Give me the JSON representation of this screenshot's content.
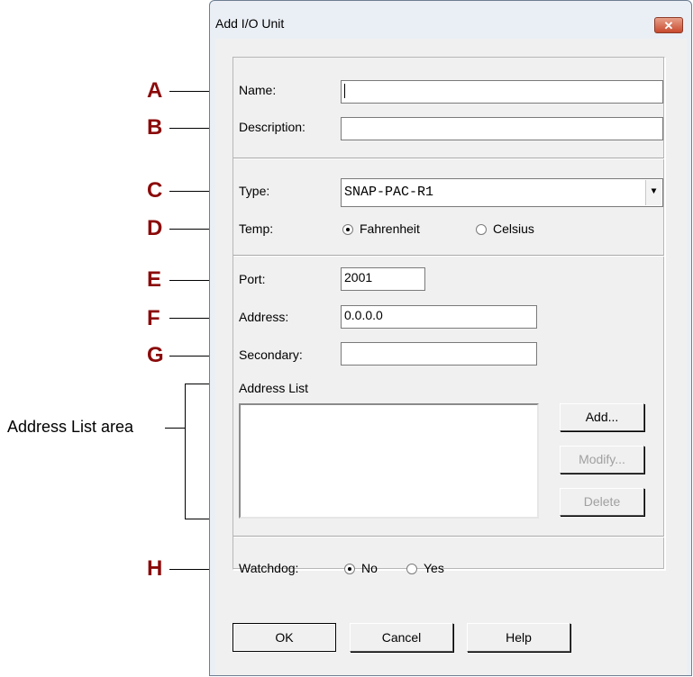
{
  "window": {
    "title": "Add I/O Unit",
    "close_glyph": "✕"
  },
  "fields": {
    "name_label": "Name:",
    "name_value": "",
    "description_label": "Description:",
    "description_value": "",
    "type_label": "Type:",
    "type_value": "SNAP-PAC-R1",
    "temp_label": "Temp:",
    "temp_options": [
      "Fahrenheit",
      "Celsius"
    ],
    "temp_selected": "Fahrenheit",
    "port_label": "Port:",
    "port_value": "2001",
    "address_label": "Address:",
    "address_value": "0.0.0.0",
    "secondary_label": "Secondary:",
    "secondary_value": "",
    "address_list_label": "Address List",
    "watchdog_label": "Watchdog:",
    "watchdog_options": [
      "No",
      "Yes"
    ],
    "watchdog_selected": "No"
  },
  "list_buttons": {
    "add": "Add...",
    "modify": "Modify...",
    "delete": "Delete"
  },
  "footer_buttons": {
    "ok": "OK",
    "cancel": "Cancel",
    "help": "Help"
  },
  "callouts": {
    "a": "A",
    "b": "B",
    "c": "C",
    "d": "D",
    "e": "E",
    "f": "F",
    "g": "G",
    "h": "H",
    "address_list_area": "Address List area"
  },
  "icons": {
    "dropdown": "chevron-down-icon",
    "close": "close-icon"
  }
}
